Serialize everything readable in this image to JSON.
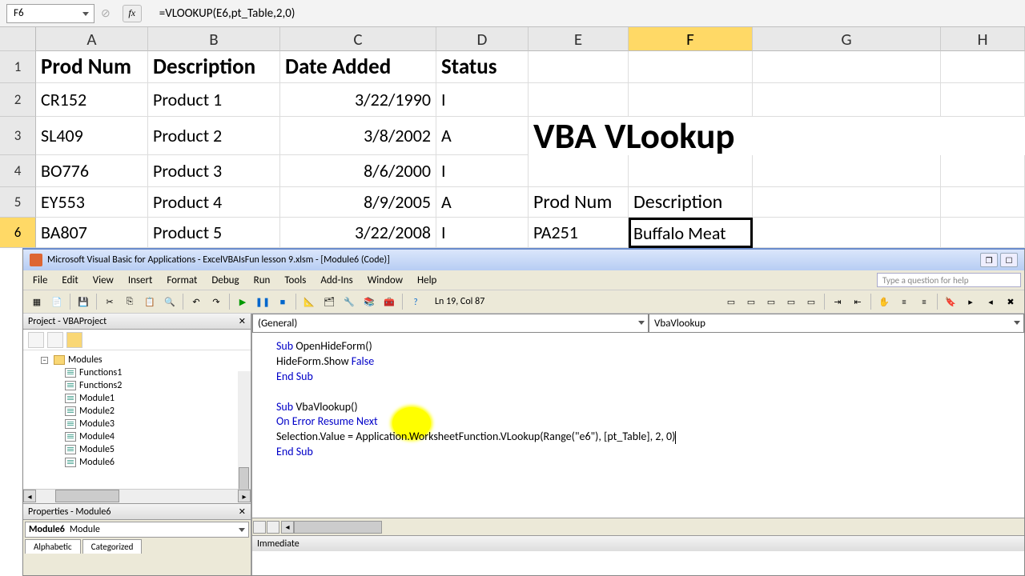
{
  "formula_bar": {
    "name_box": "F6",
    "fx": "fx",
    "formula": "=VLOOKUP(E6,pt_Table,2,0)"
  },
  "columns": [
    "A",
    "B",
    "C",
    "D",
    "E",
    "F",
    "G",
    "H"
  ],
  "rows": [
    "1",
    "2",
    "3",
    "4",
    "5",
    "6"
  ],
  "selected_col": "F",
  "selected_row": "6",
  "headers": {
    "A": "Prod Num",
    "B": "Description",
    "C": "Date Added",
    "D": "Status"
  },
  "data_rows": [
    {
      "A": "CR152",
      "B": "Product 1",
      "C": "3/22/1990",
      "D": "I"
    },
    {
      "A": "SL409",
      "B": "Product 2",
      "C": "3/8/2002",
      "D": "A"
    },
    {
      "A": "BO776",
      "B": "Product 3",
      "C": "8/6/2000",
      "D": "I"
    },
    {
      "A": "EY553",
      "B": "Product 4",
      "C": "8/9/2005",
      "D": "A"
    },
    {
      "A": "BA807",
      "B": "Product 5",
      "C": "3/22/2008",
      "D": "I"
    }
  ],
  "side": {
    "title": "VBA VLookup",
    "h1": "Prod Num",
    "h2": "Description",
    "val1": "PA251",
    "val2": "Buffalo Meat"
  },
  "vbe": {
    "title": "Microsoft Visual Basic for Applications - ExcelVBAIsFun lesson 9.xlsm - [Module6 (Code)]",
    "menus": [
      "File",
      "Edit",
      "View",
      "Insert",
      "Format",
      "Debug",
      "Run",
      "Tools",
      "Add-Ins",
      "Window",
      "Help"
    ],
    "help_placeholder": "Type a question for help",
    "cursor_pos": "Ln 19, Col 87",
    "project_title": "Project - VBAProject",
    "modules_label": "Modules",
    "modules": [
      "Functions1",
      "Functions2",
      "Module1",
      "Module2",
      "Module3",
      "Module4",
      "Module5",
      "Module6"
    ],
    "properties_title": "Properties - Module6",
    "prop_name": "Module6",
    "prop_type": "Module",
    "prop_tabs": [
      "Alphabetic",
      "Categorized"
    ],
    "combo_left": "(General)",
    "combo_right": "VbaVlookup",
    "immediate_title": "Immediate",
    "code": {
      "l1_kw1": "Sub",
      "l1_rest": " OpenHideForm()",
      "l2_a": "HideForm.Show ",
      "l2_kw": "False",
      "l3": "End Sub",
      "l5_kw": "Sub",
      "l5_rest": " VbaVlookup()",
      "l6_kw": "On Error Resume Next",
      "l7": "Selection.Value = Application.WorksheetFunction.VLookup(Range(\"e6\"), [pt_Table], 2, 0)",
      "l8": "End Sub"
    }
  }
}
